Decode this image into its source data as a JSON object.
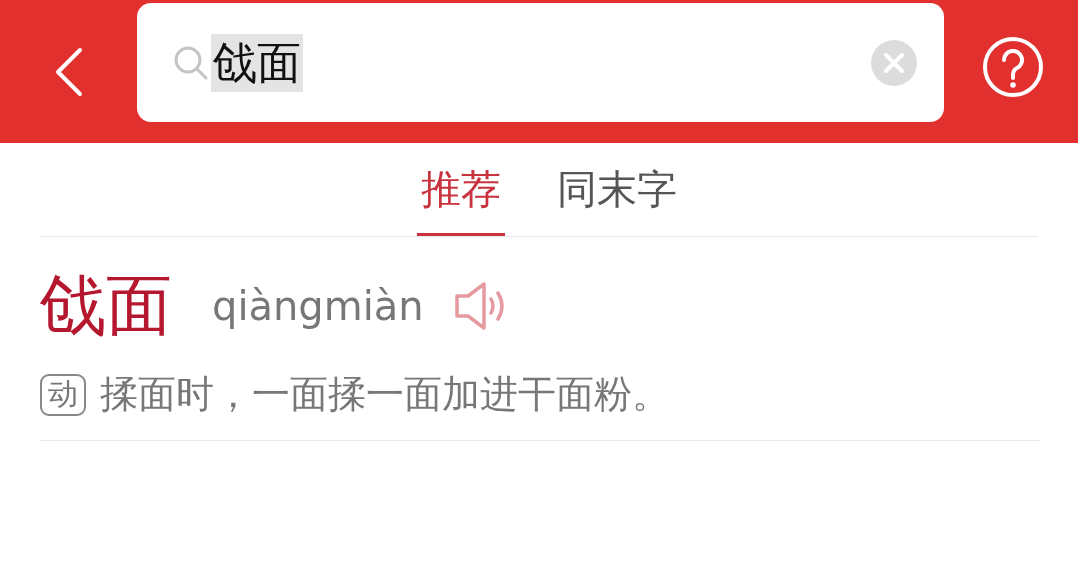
{
  "search": {
    "value": "戗面"
  },
  "tabs": [
    {
      "label": "推荐",
      "selected": true
    },
    {
      "label": "同末字",
      "selected": false
    }
  ],
  "entries": [
    {
      "word": "戗面",
      "pinyin": "qiàngmiàn",
      "definitions": [
        {
          "pos": "动",
          "text": "揉面时，一面揉一面加进干面粉。"
        }
      ]
    }
  ]
}
